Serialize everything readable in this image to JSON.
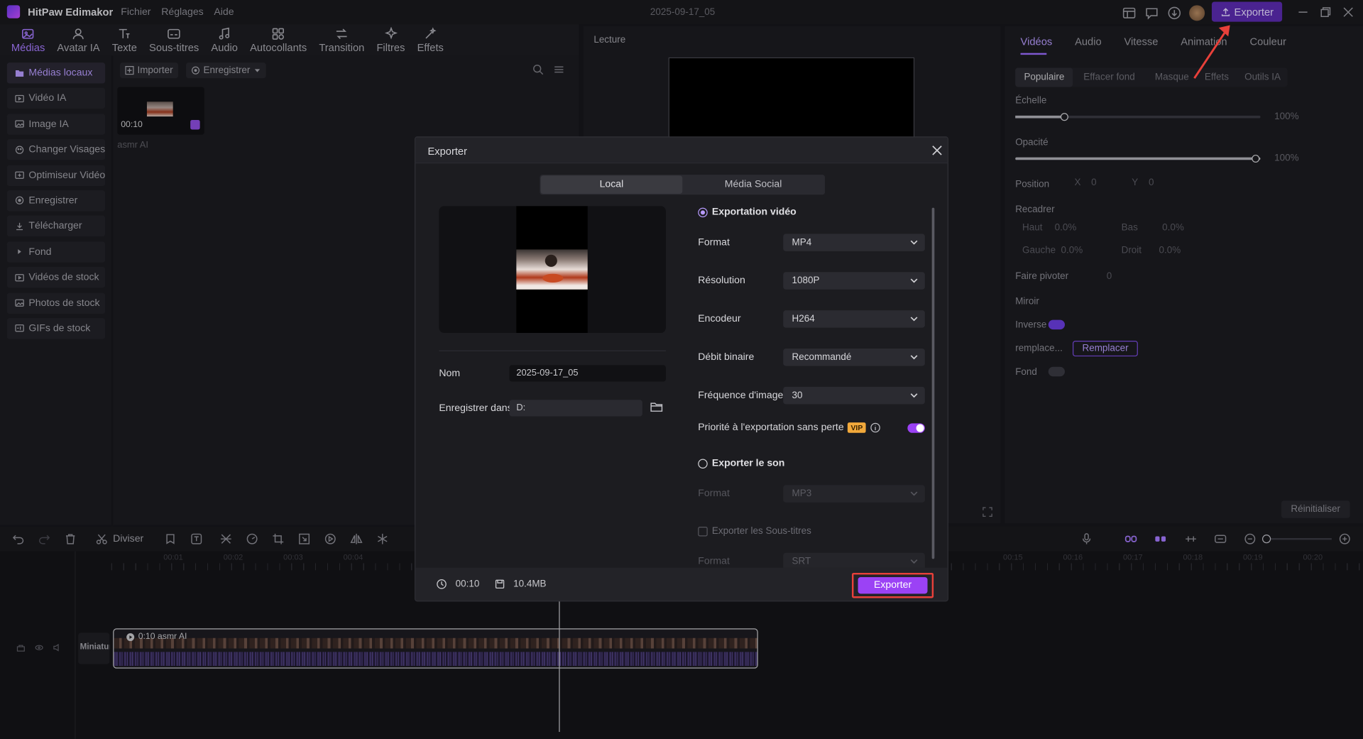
{
  "app": {
    "name": "HitPaw Edimakor",
    "menu": [
      "Fichier",
      "Réglages",
      "Aide"
    ],
    "doc_title": "2025-09-17_05",
    "export_label": "Exporter"
  },
  "toolbar": [
    {
      "label": "Médias",
      "icon": "media-icon"
    },
    {
      "label": "Avatar IA",
      "icon": "avatar-icon"
    },
    {
      "label": "Texte",
      "icon": "text-icon"
    },
    {
      "label": "Sous-titres",
      "icon": "subtitles-icon"
    },
    {
      "label": "Audio",
      "icon": "audio-icon"
    },
    {
      "label": "Autocollants",
      "icon": "stickers-icon"
    },
    {
      "label": "Transition",
      "icon": "transition-icon"
    },
    {
      "label": "Filtres",
      "icon": "filters-icon"
    },
    {
      "label": "Effets",
      "icon": "effects-icon"
    }
  ],
  "sidebar": [
    "Médias locaux",
    "Vidéo IA",
    "Image IA",
    "Changer Visages",
    "Optimiseur Vidéo",
    "Enregistrer",
    "Télécharger",
    "Fond",
    "Vidéos de stock",
    "Photos de stock",
    "GIFs de stock"
  ],
  "media": {
    "import_label": "Importer",
    "record_label": "Enregistrer",
    "clip_duration": "00:10",
    "clip_name": "asmr AI"
  },
  "preview": {
    "title": "Lecture"
  },
  "right": {
    "tabs": [
      "Vidéos",
      "Audio",
      "Vitesse",
      "Animation",
      "Couleur"
    ],
    "subtabs": [
      "Populaire",
      "Effacer fond",
      "Masque",
      "Effets",
      "Outils IA"
    ],
    "echelle": "Échelle",
    "echelle_val": "100%",
    "opacite": "Opacité",
    "opacite_val": "100%",
    "position": "Position",
    "x": "X",
    "x_val": "0",
    "y": "Y",
    "y_val": "0",
    "recadrer": "Recadrer",
    "haut": "Haut",
    "haut_val": "0.0%",
    "bas": "Bas",
    "bas_val": "0.0%",
    "gauche": "Gauche",
    "gauche_val": "0.0%",
    "droit": "Droit",
    "droit_val": "0.0%",
    "pivoter": "Faire pivoter",
    "pivoter_val": "0",
    "miroir": "Miroir",
    "inverse": "Inverse",
    "remplace": "remplace...",
    "remplacer_btn": "Remplacer",
    "fond": "Fond",
    "reset": "Réinitialiser"
  },
  "timeline": {
    "split": "Diviser",
    "ticks": [
      "00:01",
      "00:02",
      "00:03",
      "00:04",
      "00:15",
      "00:16",
      "00:17",
      "00:18",
      "00:19",
      "00:20"
    ],
    "clip_label": "0:10 asmr AI",
    "track_label": "Miniatur"
  },
  "modal": {
    "title": "Exporter",
    "tab_local": "Local",
    "tab_social": "Média Social",
    "name_label": "Nom",
    "name_value": "2025-09-17_05",
    "save_label": "Enregistrer dans",
    "save_value": "D:",
    "video_export": "Exportation vidéo",
    "format_label": "Format",
    "format_value": "MP4",
    "resolution_label": "Résolution",
    "resolution_value": "1080P",
    "encoder_label": "Encodeur",
    "encoder_value": "H264",
    "bitrate_label": "Débit binaire",
    "bitrate_value": "Recommandé",
    "fps_label": "Fréquence d'image",
    "fps_value": "30",
    "lossless_label": "Priorité à l'exportation sans perte",
    "vip": "VIP",
    "sound_export": "Exporter le son",
    "sound_format_label": "Format",
    "sound_format_value": "MP3",
    "subs_export": "Exporter les Sous-titres",
    "subs_format_label": "Format",
    "subs_format_value": "SRT",
    "duration": "00:10",
    "size": "10.4MB",
    "export_btn": "Exporter"
  },
  "colors": {
    "accent": "#9b42f5",
    "highlight": "#e8403a",
    "bg": "#17171b"
  }
}
